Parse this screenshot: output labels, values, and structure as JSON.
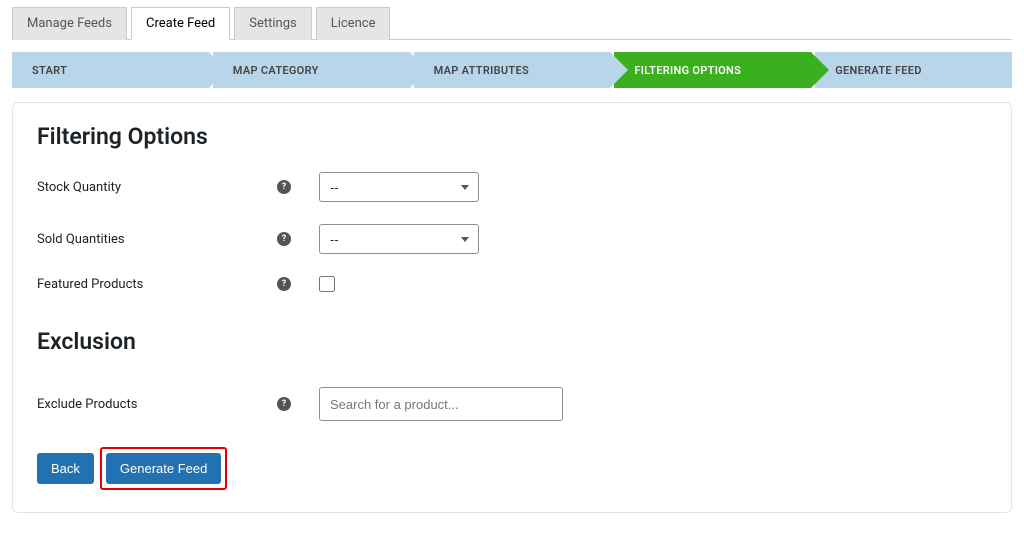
{
  "tabs": {
    "manage": "Manage Feeds",
    "create": "Create Feed",
    "settings": "Settings",
    "licence": "Licence"
  },
  "steps": {
    "start": "START",
    "map_category": "MAP CATEGORY",
    "map_attributes": "MAP ATTRIBUTES",
    "filtering": "FILTERING OPTIONS",
    "generate": "GENERATE FEED"
  },
  "section": {
    "title": "Filtering Options",
    "exclusion_title": "Exclusion"
  },
  "fields": {
    "stock_qty_label": "Stock Quantity",
    "stock_qty_value": "--",
    "sold_qty_label": "Sold Quantities",
    "sold_qty_value": "--",
    "featured_label": "Featured Products",
    "exclude_label": "Exclude Products",
    "exclude_placeholder": "Search for a product..."
  },
  "buttons": {
    "back": "Back",
    "generate": "Generate Feed"
  },
  "icons": {
    "help": "?"
  }
}
